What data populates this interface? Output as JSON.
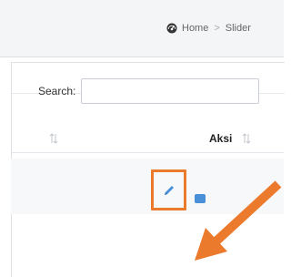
{
  "breadcrumb": {
    "items": [
      {
        "label": "Home"
      },
      {
        "label": "Slider"
      }
    ],
    "separator": ">"
  },
  "search": {
    "label": "Search:",
    "value": "",
    "placeholder": ""
  },
  "table": {
    "columns": [
      {
        "label": ""
      },
      {
        "label": "Aksi"
      }
    ]
  },
  "row_actions": {
    "edit_icon": "pencil-icon",
    "delete_icon": "trash-icon"
  },
  "annotation": {
    "highlight_color": "#ec7a2d",
    "arrow_color": "#ec7a2d"
  },
  "icons": {
    "home": "dashboard-icon",
    "sort": "sort-arrows-icon"
  },
  "colors": {
    "accent": "#4a90d9",
    "header_bg": "#f4f5f7"
  }
}
